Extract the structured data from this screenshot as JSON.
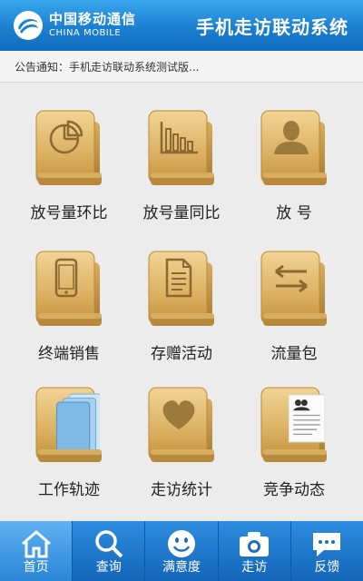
{
  "header": {
    "brand_cn": "中国移动通信",
    "brand_en": "CHINA MOBILE",
    "title": "手机走访联动系统"
  },
  "notice": {
    "text": "公告通知：手机走访联动系统测试版..."
  },
  "tiles": [
    {
      "label": "放号量环比",
      "icon": "pie-chart-icon"
    },
    {
      "label": "放号量同比",
      "icon": "bar-chart-icon"
    },
    {
      "label": "放  号",
      "icon": "user-icon"
    },
    {
      "label": "终端销售",
      "icon": "phone-icon"
    },
    {
      "label": "存赠活动",
      "icon": "document-icon"
    },
    {
      "label": "流量包",
      "icon": "transfer-arrows-icon"
    },
    {
      "label": "工作轨迹",
      "icon": "blue-pages-icon"
    },
    {
      "label": "走访统计",
      "icon": "heart-icon"
    },
    {
      "label": "竞争动态",
      "icon": "contact-card-icon"
    }
  ],
  "tabbar": [
    {
      "label": "首页",
      "icon": "home-icon",
      "active": true
    },
    {
      "label": "查询",
      "icon": "search-icon",
      "active": false
    },
    {
      "label": "满意度",
      "icon": "smiley-icon",
      "active": false
    },
    {
      "label": "走访",
      "icon": "camera-icon",
      "active": false
    },
    {
      "label": "反馈",
      "icon": "chat-bubble-icon",
      "active": false
    }
  ],
  "colors": {
    "header": "#1b7fd0",
    "folder": "#e0b96a",
    "tab_active": "#5fb1f2"
  }
}
